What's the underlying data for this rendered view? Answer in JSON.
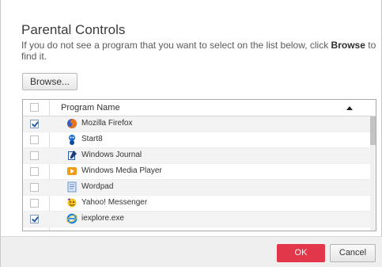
{
  "dialog": {
    "title": "Parental Controls",
    "description_prefix": "If you do not see a program that you want to select on the list below, click ",
    "description_bold": "Browse",
    "description_suffix": " to find it.",
    "browse_label": "Browse..."
  },
  "table": {
    "column_header": "Program Name",
    "select_all_checked": false,
    "rows": [
      {
        "name": "Mozilla Firefox",
        "checked": true,
        "icon": "firefox-icon"
      },
      {
        "name": "Start8",
        "checked": false,
        "icon": "start8-icon"
      },
      {
        "name": "Windows Journal",
        "checked": false,
        "icon": "windows-journal-icon"
      },
      {
        "name": "Windows Media Player",
        "checked": false,
        "icon": "media-player-icon"
      },
      {
        "name": "Wordpad",
        "checked": false,
        "icon": "wordpad-icon"
      },
      {
        "name": "Yahoo! Messenger",
        "checked": false,
        "icon": "yahoo-messenger-icon"
      },
      {
        "name": "iexplore.exe",
        "checked": true,
        "icon": "internet-explorer-icon"
      }
    ]
  },
  "footer": {
    "ok_label": "OK",
    "cancel_label": "Cancel"
  },
  "colors": {
    "ok_accent": "#e2364a"
  }
}
